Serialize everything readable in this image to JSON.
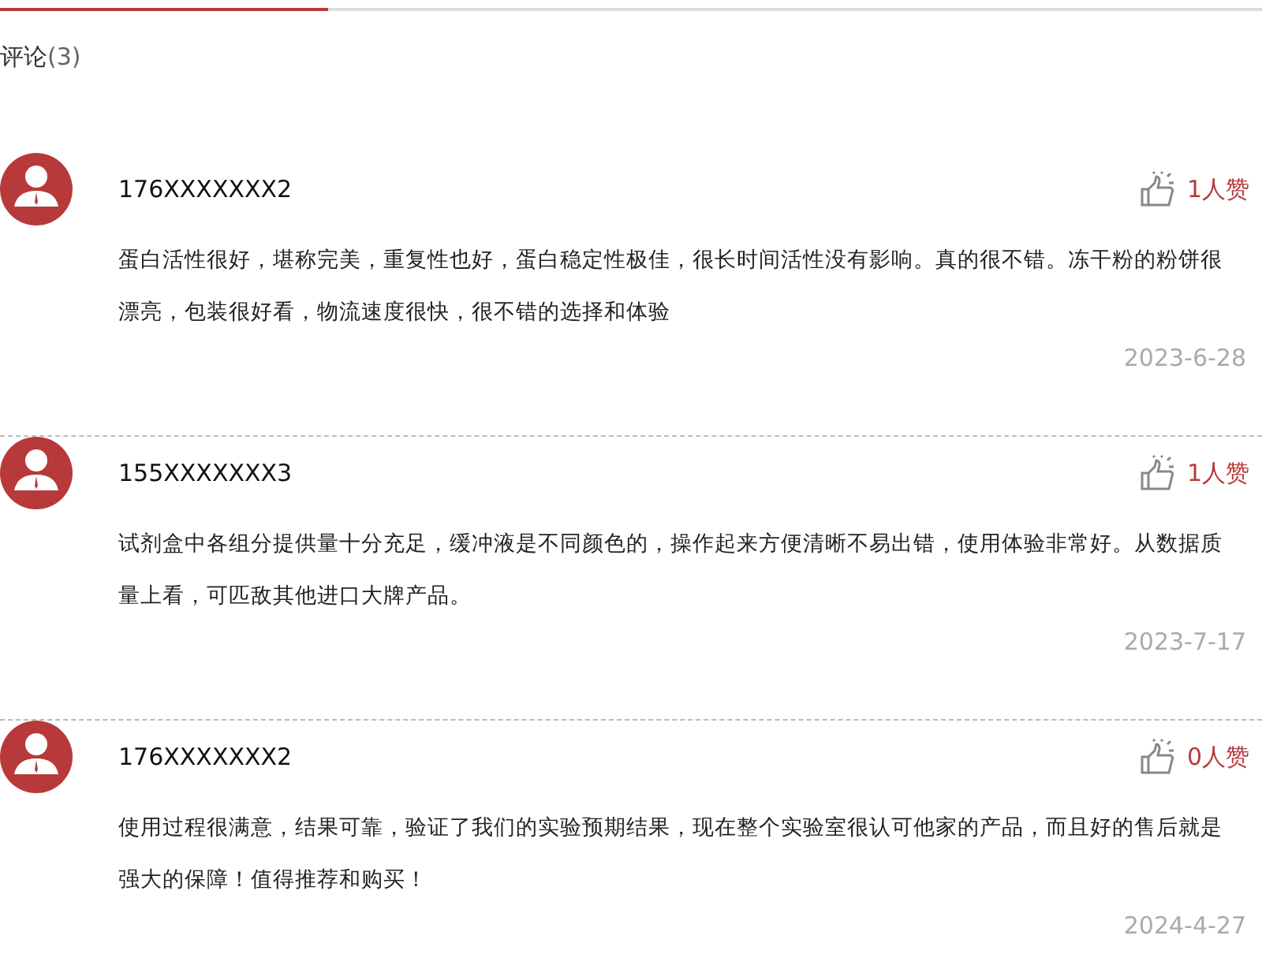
{
  "tabs_underline": {
    "level": 0.26
  },
  "heading": {
    "label": "评论",
    "count": "(3)"
  },
  "comments": [
    {
      "user": "176XXXXXXX2",
      "likes": "1人赞",
      "text": "蛋白活性很好，堪称完美，重复性也好，蛋白稳定性极佳，很长时间活性没有影响。真的很不错。冻干粉的粉饼很漂亮，包装很好看，物流速度很快，很不错的选择和体验",
      "date": "2023-6-28"
    },
    {
      "user": "155XXXXXXX3",
      "likes": "1人赞",
      "text": "试剂盒中各组分提供量十分充足，缓冲液是不同颜色的，操作起来方便清晰不易出错，使用体验非常好。从数据质量上看，可匹敌其他进口大牌产品。",
      "date": "2023-7-17"
    },
    {
      "user": "176XXXXXXX2",
      "likes": "0人赞",
      "text": "使用过程很满意，结果可靠，验证了我们的实验预期结果，现在整个实验室很认可他家的产品，而且好的售后就是强大的保障！值得推荐和购买！",
      "date": "2024-4-27"
    }
  ]
}
